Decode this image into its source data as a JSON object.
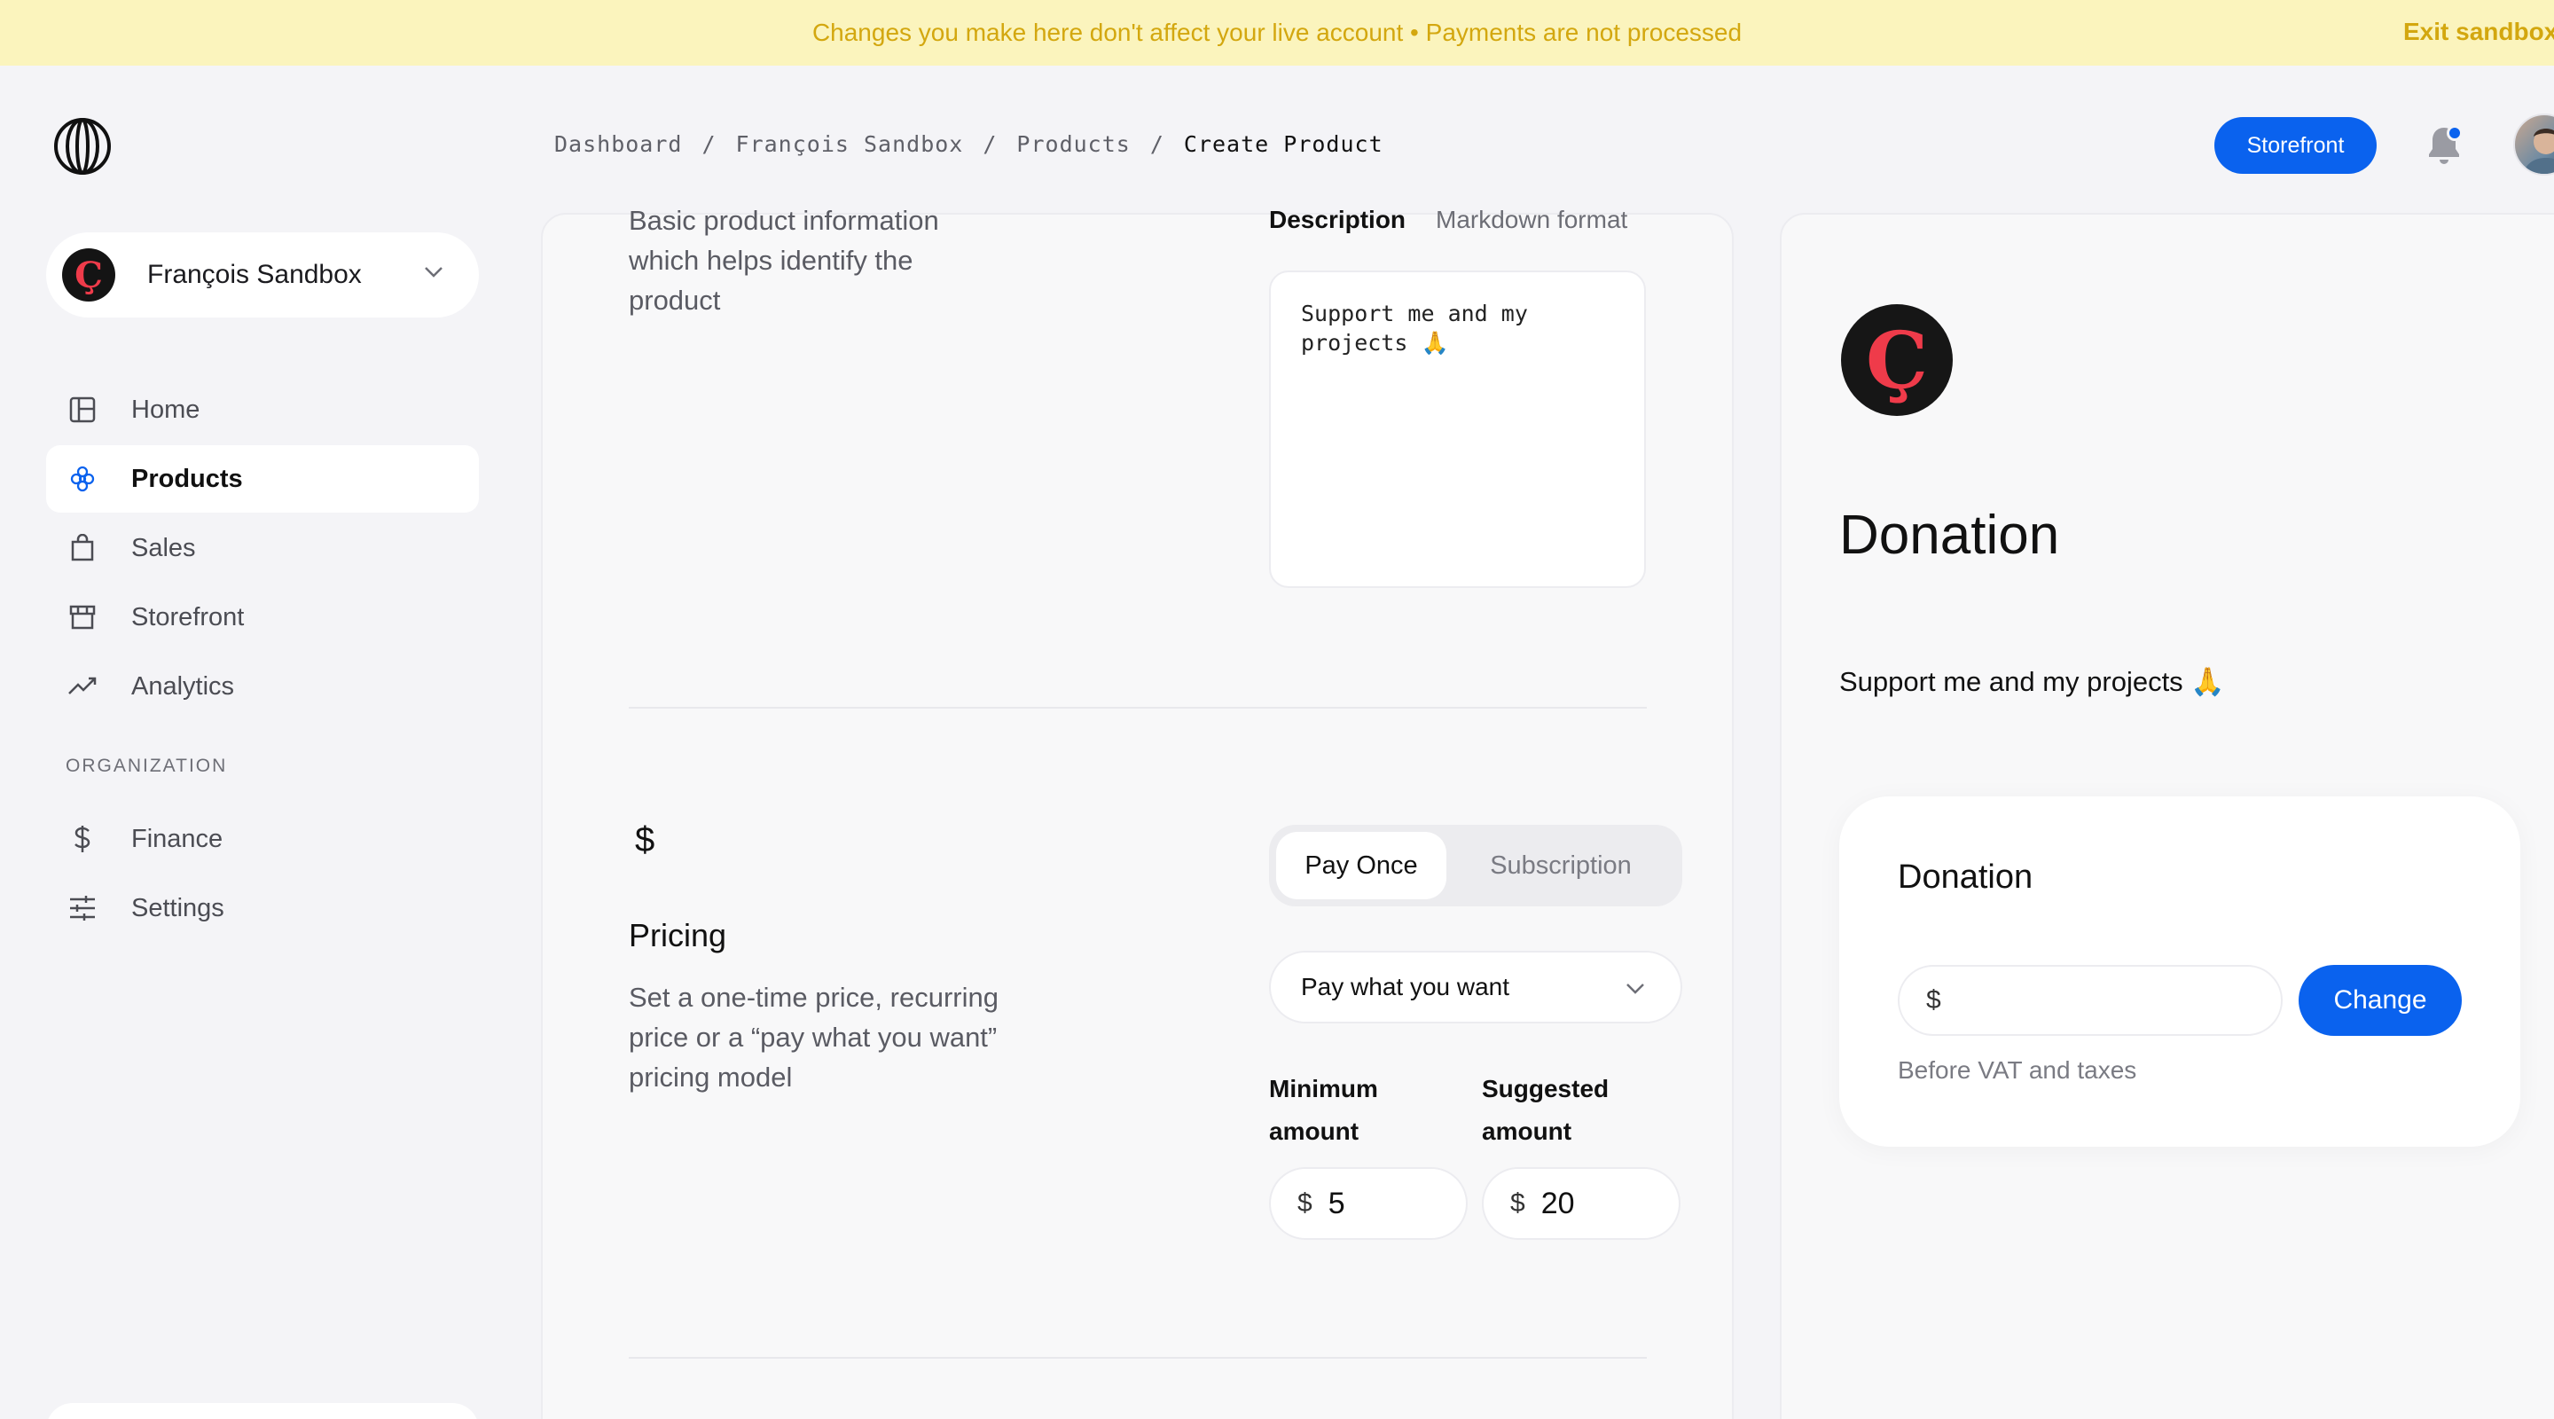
{
  "banner": {
    "message": "Changes you make here don't affect your live account • Payments are not processed",
    "exit_label": "Exit sandbox"
  },
  "breadcrumb": [
    {
      "label": "Dashboard"
    },
    {
      "label": "François Sandbox"
    },
    {
      "label": "Products"
    },
    {
      "label": "Create Product"
    }
  ],
  "breadcrumb_separator": "/",
  "header": {
    "storefront_label": "Storefront",
    "notification_icon": "bell-icon"
  },
  "org": {
    "name": "François Sandbox",
    "logo_letter": "Ç"
  },
  "sidebar": {
    "items": [
      {
        "label": "Home",
        "icon": "layout-icon",
        "active": false
      },
      {
        "label": "Products",
        "icon": "hexagon-cluster-icon",
        "active": true
      },
      {
        "label": "Sales",
        "icon": "shopping-bag-icon",
        "active": false
      },
      {
        "label": "Storefront",
        "icon": "store-icon",
        "active": false
      },
      {
        "label": "Analytics",
        "icon": "trending-up-icon",
        "active": false
      }
    ],
    "section_label": "ORGANIZATION",
    "org_items": [
      {
        "label": "Finance",
        "icon": "dollar-icon"
      },
      {
        "label": "Settings",
        "icon": "sliders-icon"
      }
    ]
  },
  "form": {
    "basic_description": "Basic product information which helps identify the product",
    "description_label": "Description",
    "description_hint": "Markdown format",
    "description_value": "Support me and my projects 🙏",
    "pricing": {
      "icon_glyph": "$",
      "title": "Pricing",
      "description": "Set a one-time price, recurring price or a “pay what you want” pricing model",
      "toggle_options": [
        "Pay Once",
        "Subscription"
      ],
      "selected_toggle": "Pay Once",
      "model_selected": "Pay what you want",
      "minimum_label": "Minimum amount",
      "suggested_label": "Suggested amount",
      "currency_symbol": "$",
      "minimum_value": "5",
      "suggested_value": "20"
    }
  },
  "preview": {
    "logo_letter": "Ç",
    "title": "Donation",
    "description": "Support me and my projects 🙏",
    "checkout": {
      "title": "Donation",
      "currency_symbol": "$",
      "button_label": "Change",
      "note": "Before VAT and taxes"
    }
  },
  "colors": {
    "accent": "#0a62ee",
    "banner_bg": "#fbf4bd",
    "banner_text": "#d3a70f",
    "brand_red": "#ef3b4a"
  }
}
